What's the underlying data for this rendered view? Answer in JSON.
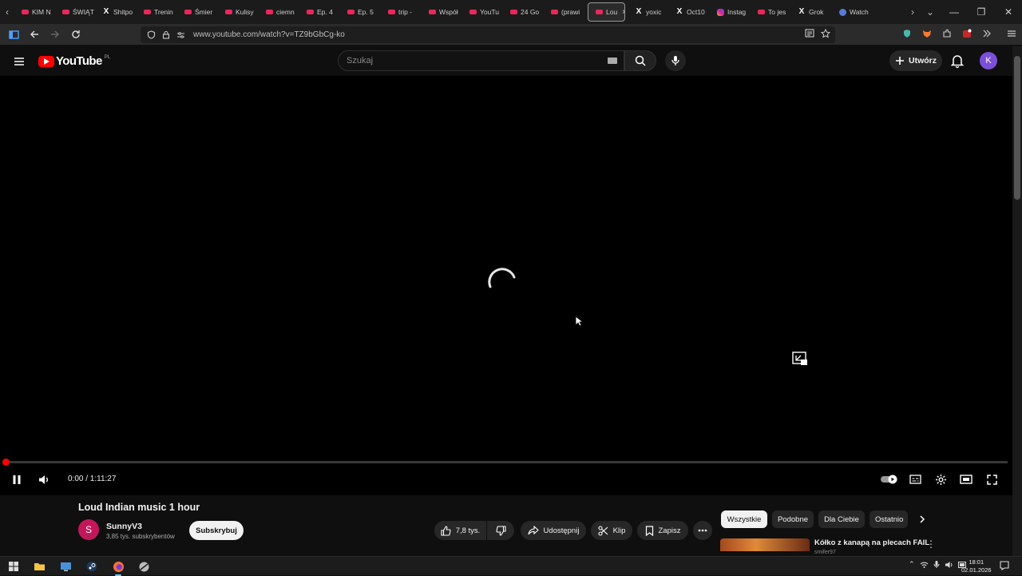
{
  "browser": {
    "tabs": [
      {
        "label": "KIM N",
        "icon": "youtube"
      },
      {
        "label": "ŚWIĄT",
        "icon": "youtube"
      },
      {
        "label": "Shitpo",
        "icon": "x"
      },
      {
        "label": "Trenin",
        "icon": "youtube"
      },
      {
        "label": "Śmier",
        "icon": "youtube"
      },
      {
        "label": "Kulisy",
        "icon": "youtube"
      },
      {
        "label": "ciemn",
        "icon": "youtube"
      },
      {
        "label": "Ep. 4",
        "icon": "youtube"
      },
      {
        "label": "Ep. 5",
        "icon": "youtube"
      },
      {
        "label": "trip -",
        "icon": "youtube"
      },
      {
        "label": "Współ",
        "icon": "youtube"
      },
      {
        "label": "YouTu",
        "icon": "youtube"
      },
      {
        "label": "24 Go",
        "icon": "youtube"
      },
      {
        "label": "(prawi",
        "icon": "youtube"
      },
      {
        "label": "Lou",
        "icon": "youtube",
        "active": true
      },
      {
        "label": "yoxic",
        "icon": "x"
      },
      {
        "label": "Oct10",
        "icon": "x"
      },
      {
        "label": "Instag",
        "icon": "instagram"
      },
      {
        "label": "To jes",
        "icon": "youtube"
      },
      {
        "label": "Grok",
        "icon": "x"
      },
      {
        "label": "Watch",
        "icon": "grok"
      }
    ],
    "url": "www.youtube.com/watch?v=TZ9bGbCg-ko"
  },
  "youtube": {
    "logo_text": "YouTube",
    "country_code": "PL",
    "search_placeholder": "Szukaj",
    "create_label": "Utwórz",
    "avatar_letter": "K"
  },
  "player": {
    "current_time": "0:00",
    "duration": "1:11:27",
    "time_display": "0:00 / 1:11:27",
    "progress": 0,
    "state": "loading"
  },
  "video": {
    "title": "Loud Indian music 1 hour",
    "channel_name": "SunnyV3",
    "channel_avatar_letter": "S",
    "subscribers": "3,85 tys. subskrybentów",
    "subscribe_label": "Subskrybuj",
    "likes": "7,8 tys.",
    "share_label": "Udostępnij",
    "clip_label": "Klip",
    "save_label": "Zapisz"
  },
  "recommendations": {
    "chips": [
      "Wszystkie",
      "Podobne",
      "Dla Ciebie",
      "Ostatnio"
    ],
    "first_title": "Kółko z kanapą na plecach FAIL",
    "first_channel": "smifer97"
  },
  "taskbar": {
    "time": "18:01",
    "date": "02.01.2026"
  },
  "colors": {
    "youtube_red": "#ff0000",
    "background": "#0f0f0f",
    "avatar_purple": "#7c4fd8",
    "channel_avatar": "#c2185b"
  }
}
